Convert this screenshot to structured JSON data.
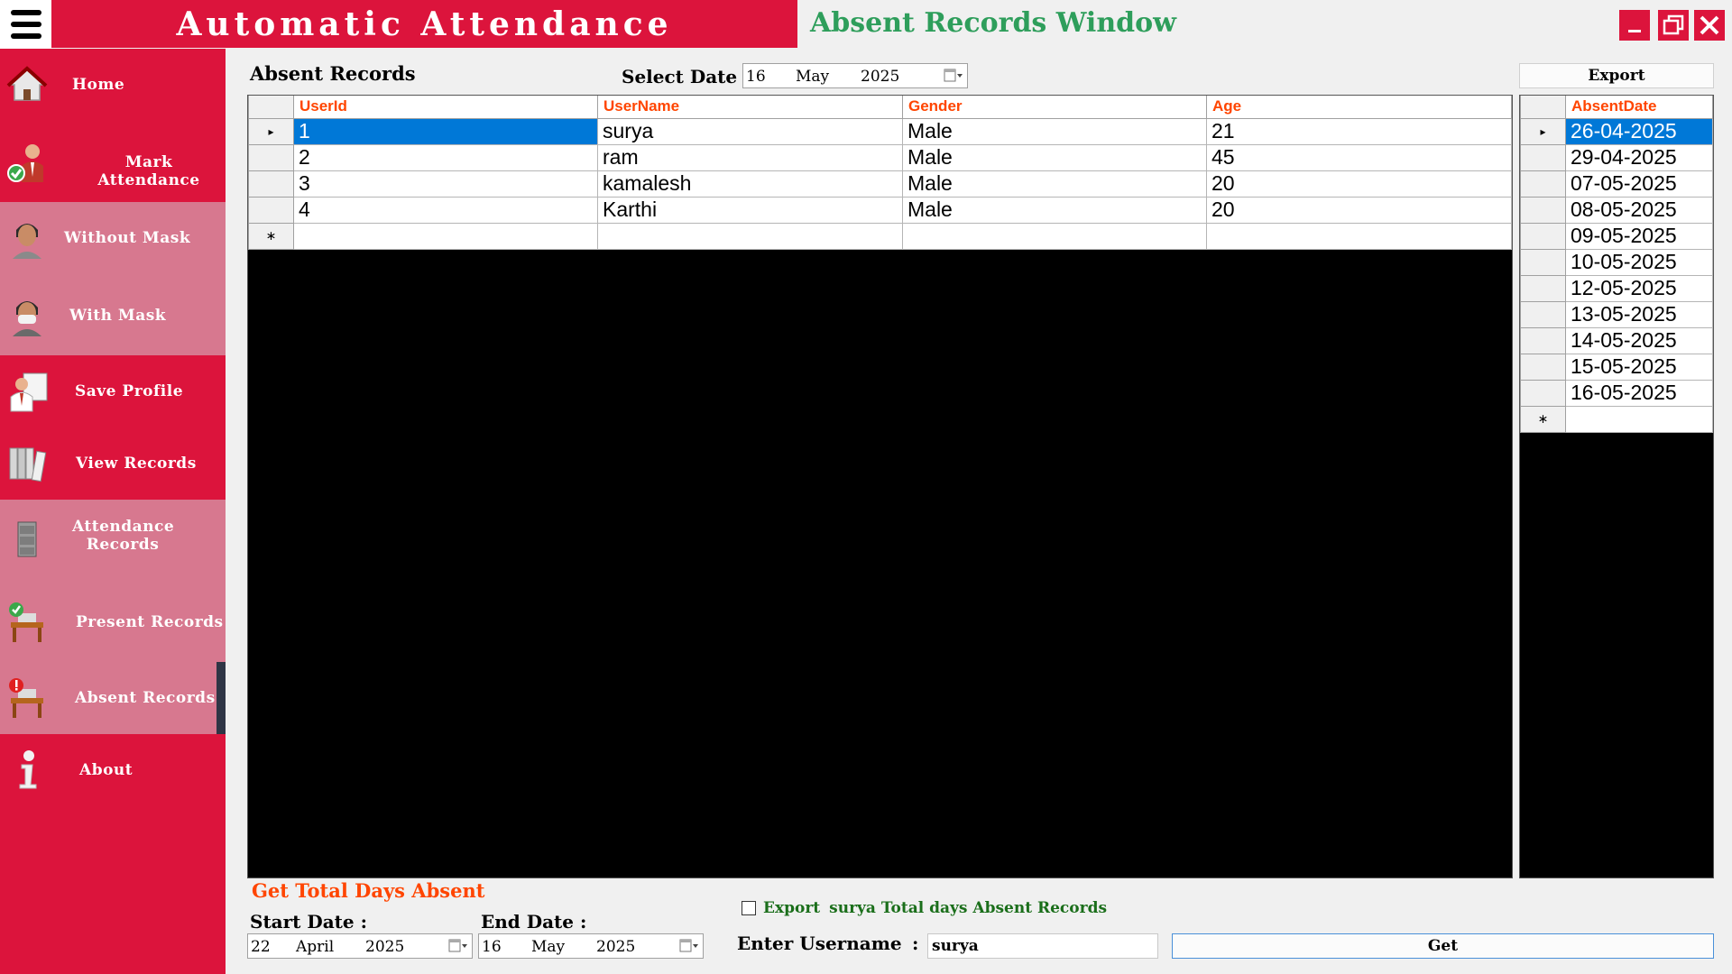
{
  "app": {
    "brand_title": "Automatic Attendance",
    "window_title": "Absent Records Window"
  },
  "sidebar": {
    "items": [
      {
        "label": "Home",
        "icon": "home-icon"
      },
      {
        "label": "Mark Attendance",
        "icon": "mark-attendance-icon"
      },
      {
        "label": "Without Mask",
        "icon": "person-icon"
      },
      {
        "label": "With Mask",
        "icon": "masked-person-icon"
      },
      {
        "label": "Save Profile",
        "icon": "save-profile-icon"
      },
      {
        "label": "View Records",
        "icon": "binders-icon"
      },
      {
        "label": "Attendance Records",
        "icon": "cabinet-icon"
      },
      {
        "label": "Present Records",
        "icon": "present-desk-icon"
      },
      {
        "label": "Absent Records",
        "icon": "absent-desk-icon"
      },
      {
        "label": "About",
        "icon": "info-icon"
      }
    ],
    "active": "Absent Records"
  },
  "main": {
    "heading": "Absent Records",
    "select_date_label": "Select Date :",
    "select_date": {
      "day": "16",
      "month": "May",
      "year": "2025"
    },
    "export_button": "Export",
    "users_table": {
      "columns": [
        "UserId",
        "UserName",
        "Gender",
        "Age"
      ],
      "rows": [
        [
          "1",
          "surya",
          "Male",
          "21"
        ],
        [
          "2",
          "ram",
          "Male",
          "45"
        ],
        [
          "3",
          "kamalesh",
          "Male",
          "20"
        ],
        [
          "4",
          "Karthi",
          "Male",
          "20"
        ]
      ],
      "selected_row": 0
    },
    "absent_table": {
      "columns": [
        "AbsentDate"
      ],
      "rows": [
        "26-04-2025",
        "29-04-2025",
        "07-05-2025",
        "08-05-2025",
        "09-05-2025",
        "10-05-2025",
        "12-05-2025",
        "13-05-2025",
        "14-05-2025",
        "15-05-2025",
        "16-05-2025"
      ],
      "selected_row": 0
    }
  },
  "bottom": {
    "section_title": "Get Total Days Absent",
    "start_date_label": "Start Date :",
    "start_date": {
      "day": "22",
      "month": "April",
      "year": "2025"
    },
    "end_date_label": "End Date :",
    "end_date": {
      "day": "16",
      "month": "May",
      "year": "2025"
    },
    "export_checkbox_label": "Export",
    "export_checked": false,
    "export_description": "surya Total days Absent Records",
    "username_label": "Enter Username",
    "username_colon": ":",
    "username_value": "surya",
    "get_button": "Get"
  },
  "colors": {
    "brand_red": "#dc143c",
    "sidebar_pink": "#d7788f",
    "window_title_green": "#2e9e5b",
    "header_orange": "#ff4500",
    "selection_blue": "#0078d7"
  }
}
